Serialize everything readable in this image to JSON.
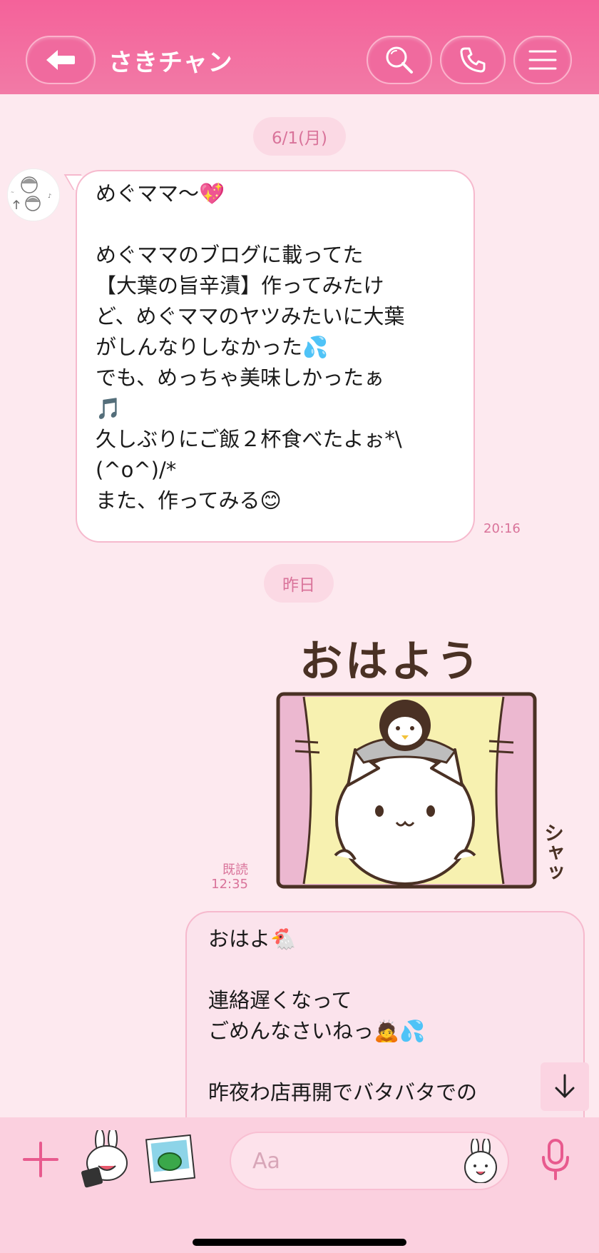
{
  "header": {
    "title": "さきチャン"
  },
  "chat": {
    "date1": "6/1(月)",
    "incoming": {
      "text": "めぐママ〜💖\n\nめぐママのブログに載ってた\n【大葉の旨辛漬】作ってみたけ\nど、めぐママのヤツみたいに大葉\nがしんなりしなかった💦\nでも、めっちゃ美味しかったぁ\n🎵\n久しぶりにご飯２杯食べたよぉ*\\\n(^o^)/*\nまた、作ってみる😊",
      "time": "20:16"
    },
    "date2": "昨日",
    "sticker": {
      "caption": "おはよう",
      "side_text": "シャッ",
      "read_label": "既読",
      "time": "12:35"
    },
    "outgoing": {
      "text": "おはよ🐔\n\n連絡遅くなって\nごめんなさいねっ🙇💦\n\n昨夜わ店再開でバタバタでの"
    }
  },
  "input": {
    "placeholder": "Aa"
  },
  "icons": {
    "back": "back-arrow-icon",
    "search": "search-icon",
    "call": "phone-icon",
    "menu": "hamburger-menu-icon",
    "plus": "plus-icon",
    "sticker": "sticker-icon",
    "photo": "photo-icon",
    "emoji": "emoji-icon",
    "mic": "microphone-icon",
    "scroll": "arrow-down-icon"
  },
  "colors": {
    "header": "#f4629a",
    "accent": "#e85a8e",
    "background": "#fde9ef"
  }
}
